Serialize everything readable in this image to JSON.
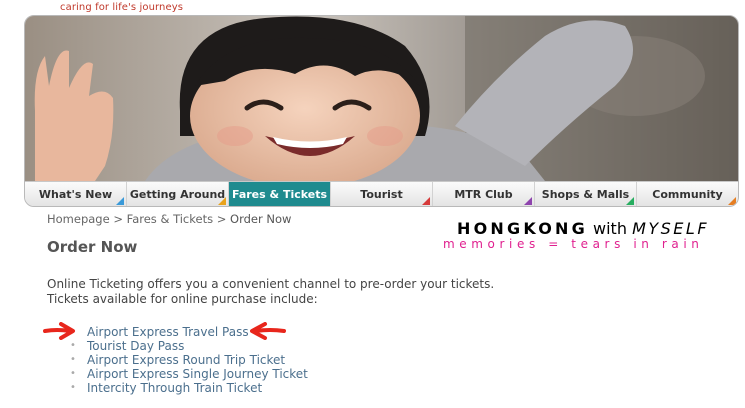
{
  "header": {
    "tagline": "caring for life's journeys"
  },
  "hero": {
    "photo": "smiling-child-waving-photo"
  },
  "nav": {
    "active_color": "#1f8b8f",
    "tabs": [
      {
        "label": "What's New",
        "accent": "#3a9ad9"
      },
      {
        "label": "Getting Around",
        "accent": "#e8a31c"
      },
      {
        "label": "Fares & Tickets",
        "accent": "#1f8b8f"
      },
      {
        "label": "Tourist",
        "accent": "#d63a3a"
      },
      {
        "label": "MTR Club",
        "accent": "#8e44ad"
      },
      {
        "label": "Shops & Malls",
        "accent": "#27ae60"
      },
      {
        "label": "Community",
        "accent": "#e67e22"
      }
    ]
  },
  "breadcrumb": {
    "home": "Homepage",
    "sep1": " > ",
    "section": "Fares & Tickets",
    "sep2": " > ",
    "current": "Order Now"
  },
  "page": {
    "title": "Order Now",
    "intro": "Online Ticketing offers you a convenient channel to pre-order your tickets. Tickets available for online purchase include:"
  },
  "tickets": [
    "Airport Express Travel Pass",
    "Tourist Day Pass",
    "Airport Express Round Trip Ticket",
    "Airport Express Single Journey Ticket",
    "Intercity Through Train Ticket"
  ],
  "watermark": {
    "w1": "HONGKONG",
    "w2": "with",
    "w3": "MYSELF",
    "subtitle": "memories = tears in rain"
  },
  "colors": {
    "link": "#4b6f8d",
    "watermark_pink": "#e0208f",
    "arrow_red": "#e8261c"
  }
}
